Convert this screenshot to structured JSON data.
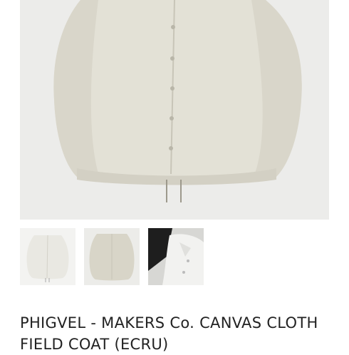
{
  "product": {
    "title": "PHIGVEL - MAKERS Co. CANVAS CLOTH FIELD COAT (ECRU)"
  },
  "gallery": {
    "thumbnails": [
      {
        "name": "front-view",
        "selected": false
      },
      {
        "name": "back-view",
        "selected": true
      },
      {
        "name": "detail-view",
        "selected": false
      }
    ]
  },
  "colors": {
    "garment": "#e3e1d6",
    "garment_shadow": "#cfccc0",
    "background": "#ececea"
  }
}
